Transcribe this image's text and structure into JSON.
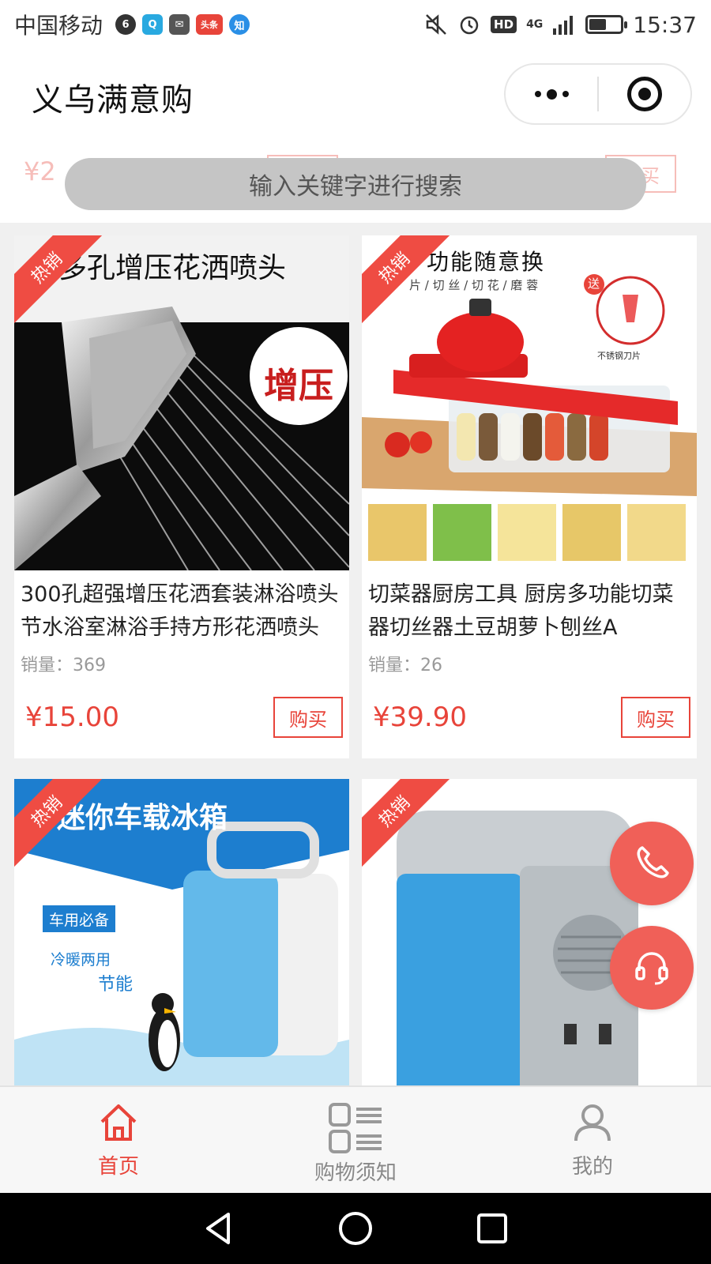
{
  "status_bar": {
    "carrier": "中国移动",
    "app_badges": [
      {
        "name": "sync-icon",
        "text": "6",
        "color": "#333333"
      },
      {
        "name": "qq-icon",
        "text": "Q",
        "color": "#29a9e0"
      },
      {
        "name": "mail-icon",
        "text": "✉",
        "color": "#555555"
      },
      {
        "name": "toutiao-icon",
        "text": "头条",
        "color": "#e8443a"
      },
      {
        "name": "zhihu-icon",
        "text": "知",
        "color": "#2a8fe6"
      }
    ],
    "hd_label": "HD",
    "network": "4G",
    "battery_level": 0.5,
    "time": "15:37"
  },
  "header": {
    "title": "义乌满意购"
  },
  "search": {
    "placeholder": "输入关键字进行搜索",
    "ghost_price": "¥2",
    "ghost_buy": "购买"
  },
  "products": [
    {
      "badge": "热销",
      "banner_text": "多孔增压花洒喷头",
      "sticker": "增压",
      "title": "300孔超强增压花洒套装淋浴喷头节水浴室淋浴手持方形花洒喷头",
      "sales_label": "销量：",
      "sales": "369",
      "price": "¥15.00",
      "buy_label": "购买"
    },
    {
      "badge": "热销",
      "banner_text": "功能随意换",
      "banner_sub": "片 / 切 丝 / 切 花 / 磨 蓉",
      "gift": "送",
      "gift_caption": "不锈钢刀片",
      "title": "切菜器厨房工具 厨房多功能切菜器切丝器土豆胡萝卜刨丝A",
      "sales_label": "销量：",
      "sales": "26",
      "price": "¥39.90",
      "buy_label": "购买"
    },
    {
      "badge": "热销",
      "banner_text": "迷你车载冰箱",
      "tag1": "车用必备",
      "tag2": "冷暖两用",
      "tag3": "节能"
    },
    {
      "badge": "热销"
    }
  ],
  "floating": {
    "phone_icon": "phone-icon",
    "service_icon": "headset-icon"
  },
  "tabs": [
    {
      "label": "首页",
      "icon": "home-icon",
      "active": true
    },
    {
      "label": "购物须知",
      "icon": "list-icon",
      "active": false
    },
    {
      "label": "我的",
      "icon": "user-icon",
      "active": false
    }
  ],
  "colors": {
    "accent": "#e8443a",
    "ribbon": "#ef4c43",
    "fab": "#f06058"
  }
}
